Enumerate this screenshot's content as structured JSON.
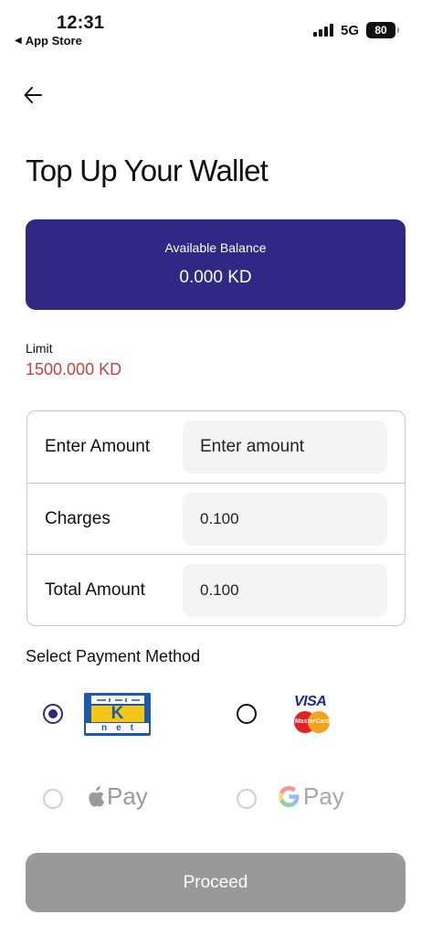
{
  "status_bar": {
    "time": "12:31",
    "back_app": "App Store",
    "network": "5G",
    "battery": "80"
  },
  "header": {
    "title": "Top Up Your Wallet"
  },
  "balance": {
    "label": "Available Balance",
    "value": "0.000 KD"
  },
  "limit": {
    "label": "Limit",
    "value": "1500.000 KD"
  },
  "amount_form": {
    "enter_amount_label": "Enter Amount",
    "enter_amount_placeholder": "Enter amount",
    "charges_label": "Charges",
    "charges_value": "0.100",
    "total_label": "Total Amount",
    "total_value": "0.100"
  },
  "payment": {
    "section_title": "Select Payment Method",
    "knet_text": "net",
    "knet_letter": "K",
    "visa_text": "VISA",
    "mastercard_text": "MasterCard",
    "apple_pay_text": "Pay",
    "google_pay_text": "Pay",
    "selected": "knet"
  },
  "actions": {
    "proceed_label": "Proceed"
  },
  "colors": {
    "accent": "#302885",
    "limit": "#c0433f",
    "button_disabled": "#999999"
  }
}
